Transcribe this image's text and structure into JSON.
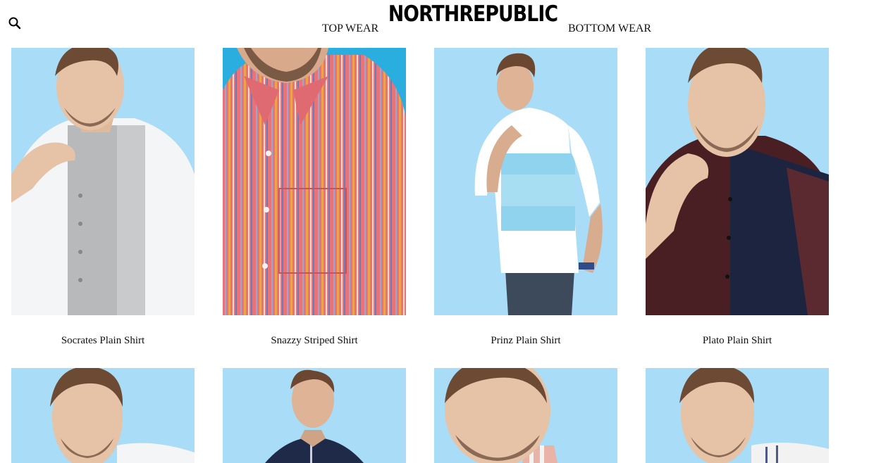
{
  "header": {
    "brand": "NORTHREPUBLIC",
    "nav": [
      {
        "label": "TOP WEAR"
      },
      {
        "label": "BOTTOM WEAR"
      }
    ],
    "search_icon": "search-icon"
  },
  "products": [
    {
      "name": "Socrates Plain Shirt",
      "image": "man-in-white-grey-panel-shirt"
    },
    {
      "name": "Snazzy Striped Shirt",
      "image": "man-in-red-striped-shirt"
    },
    {
      "name": "Prinz Plain Shirt",
      "image": "man-in-white-blue-colorblock-shirt"
    },
    {
      "name": "Plato Plain Shirt",
      "image": "man-in-maroon-navy-panel-shirt"
    },
    {
      "name": "",
      "image": "man-in-white-shirt"
    },
    {
      "name": "",
      "image": "man-in-navy-shirt"
    },
    {
      "name": "",
      "image": "man-in-checked-shirt"
    },
    {
      "name": "",
      "image": "man-in-white-striped-shirt"
    }
  ],
  "colors": {
    "background": "#ffffff",
    "photo_backdrop": "#a9dcf6",
    "text": "#111111"
  }
}
